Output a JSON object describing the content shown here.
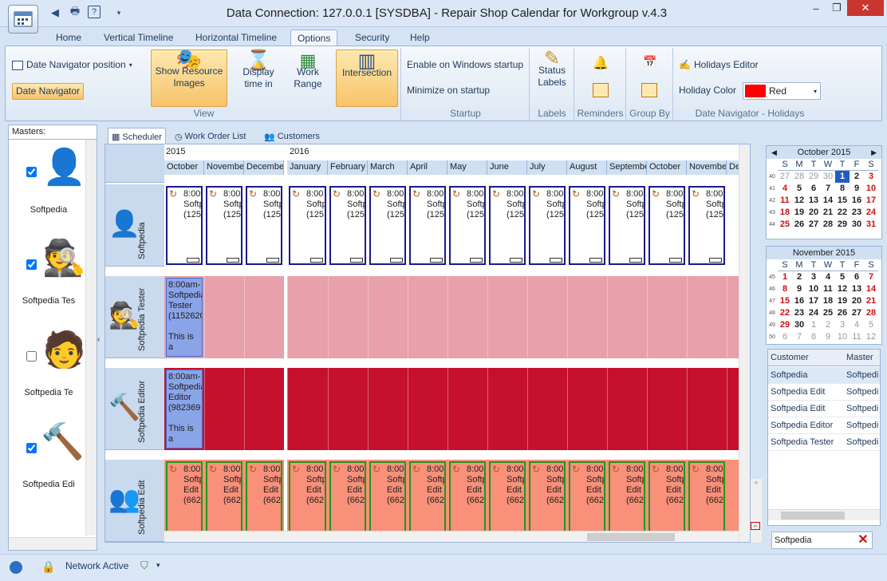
{
  "window": {
    "title": "Data Connection: 127.0.0.1 [SYSDBA] - Repair Shop Calendar for Workgroup v.4.3",
    "controls": [
      "–",
      "❐",
      "✕"
    ]
  },
  "quick_access": [
    "◀",
    "🖶",
    "?",
    "▾"
  ],
  "tabs": [
    {
      "label": "Home"
    },
    {
      "label": "Vertical Timeline"
    },
    {
      "label": "Horizontal Timeline"
    },
    {
      "label": "Options",
      "active": true
    },
    {
      "label": "Security"
    },
    {
      "label": "Help"
    }
  ],
  "ribbon": {
    "view": {
      "group_label": "View",
      "date_nav_position": "Date Navigator position",
      "date_navigator": "Date Navigator",
      "show_resource_images": "Show Resource Images",
      "display_time_in": "Display time in",
      "work_range": "Work Range",
      "intersection": "Intersection"
    },
    "startup": {
      "group_label": "Startup",
      "enable_startup": "Enable on Windows startup",
      "minimize_startup": "Minimize on startup"
    },
    "labels": {
      "group_label": "Labels",
      "status_labels": "Status Labels"
    },
    "reminders": {
      "group_label": "Reminders"
    },
    "group_by": {
      "group_label": "Group By"
    },
    "holidays": {
      "group_label": "Date Navigator - Holidays",
      "holidays_editor": "Holidays Editor",
      "holiday_color_label": "Holiday Color",
      "holiday_color_value": "Red",
      "holiday_color": "#ff0000"
    }
  },
  "masters": {
    "header": "Masters:",
    "items": [
      {
        "name": "Softpedia",
        "checked": true,
        "icon": "user-gear-icon"
      },
      {
        "name": "Softpedia Tes",
        "checked": true,
        "icon": "tester-icon"
      },
      {
        "name": "Softpedia Te",
        "checked": false,
        "icon": "manager-icon"
      },
      {
        "name": "Softpedia Edi",
        "checked": true,
        "icon": "hammer-icon"
      }
    ]
  },
  "scheduler_tabs": [
    {
      "label": "Scheduler",
      "active": true
    },
    {
      "label": "Work Order List"
    },
    {
      "label": "Customers"
    }
  ],
  "timeline": {
    "years": [
      "2015",
      "2016"
    ],
    "months": [
      "October",
      "November",
      "December",
      "January",
      "February",
      "March",
      "April",
      "May",
      "June",
      "July",
      "August",
      "September",
      "October",
      "November",
      "Decem"
    ]
  },
  "resources": [
    {
      "name": "Softpedia",
      "bg": "#ffffff",
      "appt_color": "#ffffff",
      "border": "#1a1a8c",
      "appt_lines": [
        "8:00",
        "Softp",
        "(125"
      ]
    },
    {
      "name": "Softpedia Tester",
      "bg": "#e8a0aa",
      "appt_lines": [
        "8:00am-",
        "Softpedia",
        "Tester",
        "(1152620",
        "",
        "This is a"
      ]
    },
    {
      "name": "Softpedia Editor",
      "bg": "#c5102e",
      "appt_lines": [
        "8:00am-",
        "Softpedia",
        "Editor",
        "(982369",
        "",
        "This is a"
      ]
    },
    {
      "name": "Softpedia Edit",
      "bg": "#f8907a",
      "appt_color": "#f8907a",
      "border": "#1a9a1a",
      "appt_lines": [
        "8:00",
        "Softp",
        "Edit",
        "(662"
      ]
    }
  ],
  "calendars": [
    {
      "title": "October 2015",
      "days_header": [
        "S",
        "M",
        "T",
        "W",
        "T",
        "F",
        "S"
      ],
      "weeks": [
        {
          "wk": "40",
          "days": [
            "27",
            "28",
            "29",
            "30",
            "1",
            "2",
            "3"
          ]
        },
        {
          "wk": "41",
          "days": [
            "4",
            "5",
            "6",
            "7",
            "8",
            "9",
            "10"
          ]
        },
        {
          "wk": "42",
          "days": [
            "11",
            "12",
            "13",
            "14",
            "15",
            "16",
            "17"
          ]
        },
        {
          "wk": "43",
          "days": [
            "18",
            "19",
            "20",
            "21",
            "22",
            "23",
            "24"
          ]
        },
        {
          "wk": "44",
          "days": [
            "25",
            "26",
            "27",
            "28",
            "29",
            "30",
            "31"
          ]
        }
      ]
    },
    {
      "title": "November 2015",
      "days_header": [
        "S",
        "M",
        "T",
        "W",
        "T",
        "F",
        "S"
      ],
      "weeks": [
        {
          "wk": "45",
          "days": [
            "1",
            "2",
            "3",
            "4",
            "5",
            "6",
            "7"
          ]
        },
        {
          "wk": "46",
          "days": [
            "8",
            "9",
            "10",
            "11",
            "12",
            "13",
            "14"
          ]
        },
        {
          "wk": "47",
          "days": [
            "15",
            "16",
            "17",
            "18",
            "19",
            "20",
            "21"
          ]
        },
        {
          "wk": "48",
          "days": [
            "22",
            "23",
            "24",
            "25",
            "26",
            "27",
            "28"
          ]
        },
        {
          "wk": "49",
          "days": [
            "29",
            "30",
            "1",
            "2",
            "3",
            "4",
            "5"
          ]
        },
        {
          "wk": "50",
          "days": [
            "6",
            "7",
            "8",
            "9",
            "10",
            "11",
            "12"
          ]
        }
      ]
    }
  ],
  "customer_grid": {
    "columns": [
      "Customer",
      "Master"
    ],
    "rows": [
      [
        "Softpedia",
        "Softpedi"
      ],
      [
        "Softpedia Edit",
        "Softpedi"
      ],
      [
        "Softpedia Edit",
        "Softpedi"
      ],
      [
        "Softpedia Editor",
        "Softpedi"
      ],
      [
        "Softpedia Tester",
        "Softpedi"
      ]
    ]
  },
  "filter": {
    "value": "Softpedia"
  },
  "status": {
    "network": "Network Active"
  }
}
